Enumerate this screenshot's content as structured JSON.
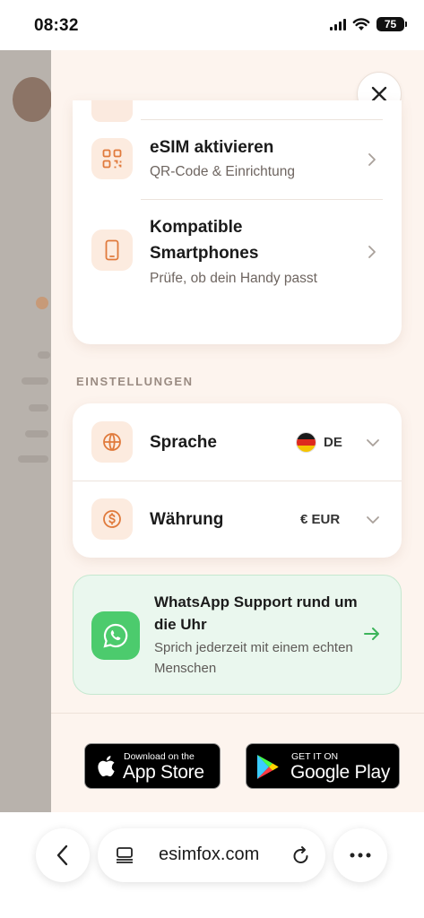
{
  "status_bar": {
    "time": "08:32",
    "battery": "75"
  },
  "menu": {
    "items": [
      {
        "title": "eSIM aktivieren",
        "subtitle": "QR-Code & Einrichtung",
        "icon": "qr-code-icon"
      },
      {
        "title_line1": "Kompatible",
        "title_line2": "Smartphones",
        "subtitle": "Prüfe, ob dein Handy passt",
        "icon": "smartphone-icon"
      }
    ]
  },
  "settings": {
    "section_label": "EINSTELLUNGEN",
    "language": {
      "label": "Sprache",
      "value": "DE",
      "icon": "globe-icon"
    },
    "currency": {
      "label": "Währung",
      "value": "€ EUR",
      "icon": "dollar-coin-icon"
    }
  },
  "whatsapp": {
    "title": "WhatsApp Support rund um die Uhr",
    "subtitle": "Sprich jederzeit mit einem echten Menschen",
    "icon": "whatsapp-icon"
  },
  "stores": {
    "apple": {
      "small": "Download on the",
      "big": "App Store"
    },
    "google": {
      "small": "GET IT ON",
      "big": "Google Play"
    }
  },
  "browser": {
    "url": "esimfox.com"
  },
  "colors": {
    "accent": "#e07a3c",
    "whatsapp_green": "#4ccb6d",
    "drawer_bg": "#fdf4ee"
  }
}
